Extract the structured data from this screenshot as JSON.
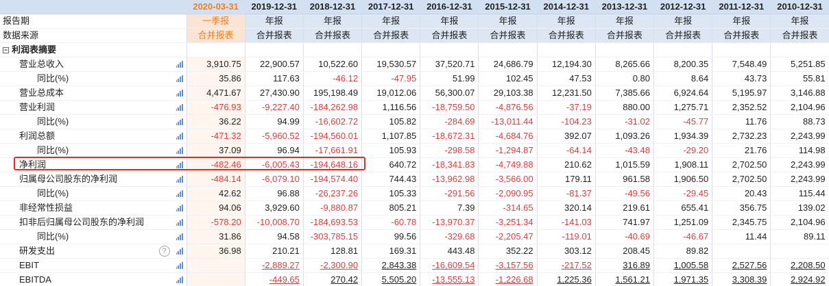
{
  "header": {
    "periods": [
      "2020-03-31",
      "2019-12-31",
      "2018-12-31",
      "2017-12-31",
      "2016-12-31",
      "2015-12-31",
      "2014-12-31",
      "2013-12-31",
      "2012-12-31",
      "2011-12-31",
      "2010-12-31"
    ]
  },
  "meta_rows": [
    {
      "label": "报告期",
      "values": [
        "一季报",
        "年报",
        "年报",
        "年报",
        "年报",
        "年报",
        "年报",
        "年报",
        "年报",
        "年报",
        "年报"
      ]
    },
    {
      "label": "数据来源",
      "values": [
        "合并报表",
        "合并报表",
        "合并报表",
        "合并报表",
        "合并报表",
        "合并报表",
        "合并报表",
        "合并报表",
        "合并报表",
        "合并报表",
        "合并报表"
      ]
    }
  ],
  "section": {
    "collapse_symbol": "−",
    "label": "利润表摘要"
  },
  "icons": {
    "help": "?",
    "accent_color": "#ef7f22",
    "negative_color": "#e23a3a",
    "highlight_color": "#e8271e"
  },
  "rows": [
    {
      "label": "营业总收入",
      "level": 1,
      "values": [
        "3,910.75",
        "22,900.57",
        "10,522.60",
        "19,530.57",
        "37,520.71",
        "24,686.79",
        "12,194.30",
        "8,265.66",
        "8,200.35",
        "7,548.49",
        "5,251.85"
      ]
    },
    {
      "label": "同比(%)",
      "level": 2,
      "values": [
        "35.86",
        "117.63",
        "-46.12",
        "-47.95",
        "51.99",
        "102.45",
        "47.53",
        "0.80",
        "8.64",
        "43.73",
        "55.81"
      ]
    },
    {
      "label": "营业总成本",
      "level": 1,
      "values": [
        "4,471.67",
        "27,430.90",
        "195,198.49",
        "19,012.06",
        "56,300.07",
        "29,103.38",
        "12,231.50",
        "7,385.66",
        "6,924.64",
        "5,195.97",
        "3,146.88"
      ]
    },
    {
      "label": "营业利润",
      "level": 1,
      "values": [
        "-476.93",
        "-9,227.40",
        "-184,262.98",
        "1,116.56",
        "-18,759.50",
        "-4,876.56",
        "-37.19",
        "880.00",
        "1,275.71",
        "2,352.52",
        "2,104.96"
      ]
    },
    {
      "label": "同比(%)",
      "level": 2,
      "values": [
        "36.22",
        "94.99",
        "-16,602.72",
        "105.82",
        "-284.69",
        "-13,011.44",
        "-104.23",
        "-31.02",
        "-45.77",
        "11.76",
        "88.73"
      ]
    },
    {
      "label": "利润总额",
      "level": 1,
      "values": [
        "-471.32",
        "-5,960.52",
        "-194,560.01",
        "1,107.85",
        "-18,672.31",
        "-4,684.76",
        "392.07",
        "1,093.26",
        "1,934.39",
        "2,732.23",
        "2,243.99"
      ]
    },
    {
      "label": "同比(%)",
      "level": 2,
      "values": [
        "37.09",
        "96.94",
        "-17,661.91",
        "105.93",
        "-298.58",
        "-1,294.87",
        "-64.14",
        "-43.48",
        "-29.20",
        "21.76",
        "114.98"
      ]
    },
    {
      "label": "净利润",
      "level": 1,
      "values": [
        "-482.46",
        "-6,005.43",
        "-194,648.16",
        "640.72",
        "-18,341.83",
        "-4,749.88",
        "210.62",
        "1,015.59",
        "1,908.11",
        "2,702.50",
        "2,243.99"
      ]
    },
    {
      "label": "归属母公司股东的净利润",
      "level": 1,
      "values": [
        "-484.14",
        "-6,079.10",
        "-194,574.40",
        "744.43",
        "-13,962.98",
        "-3,566.00",
        "179.11",
        "961.58",
        "1,906.50",
        "2,702.50",
        "2,243.99"
      ]
    },
    {
      "label": "同比(%)",
      "level": 2,
      "values": [
        "42.62",
        "96.88",
        "-26,237.26",
        "105.33",
        "-291.56",
        "-2,090.95",
        "-81.37",
        "-49.56",
        "-29.45",
        "20.43",
        "115.44"
      ]
    },
    {
      "label": "非经常性损益",
      "level": 1,
      "values": [
        "94.06",
        "3,929.60",
        "-9,880.87",
        "805.21",
        "7.39",
        "-314.65",
        "320.14",
        "219.61",
        "655.41",
        "356.75",
        "139.02"
      ]
    },
    {
      "label": "扣非后归属母公司股东的净利润",
      "level": 1,
      "values": [
        "-578.20",
        "-10,008.70",
        "-184,693.53",
        "-60.78",
        "-13,970.37",
        "-3,251.34",
        "-141.03",
        "741.97",
        "1,251.09",
        "2,345.75",
        "2,104.96"
      ]
    },
    {
      "label": "同比(%)",
      "level": 2,
      "values": [
        "31.86",
        "94.58",
        "-303,785.15",
        "99.56",
        "-329.68",
        "-2,205.47",
        "-119.01",
        "-40.69",
        "-46.67",
        "11.44",
        "89.11"
      ]
    },
    {
      "label": "研发支出",
      "level": 1,
      "help": true,
      "values": [
        "36.98",
        "210.21",
        "128.81",
        "169.31",
        "443.48",
        "352.22",
        "303.12",
        "208.45",
        "89.82",
        "",
        ""
      ]
    },
    {
      "label": "EBIT",
      "level": 1,
      "link": true,
      "values": [
        "",
        "-2,889.27",
        "-2,300.90",
        "2,843.38",
        "-16,609.54",
        "-3,157.56",
        "-217.52",
        "316.89",
        "1,005.58",
        "2,527.56",
        "2,208.50"
      ]
    },
    {
      "label": "EBITDA",
      "level": 1,
      "link": true,
      "values": [
        "",
        "-449.65",
        "270.42",
        "5,505.20",
        "-13,555.13",
        "-1,226.68",
        "1,225.36",
        "1,561.21",
        "1,971.35",
        "3,308.39",
        "2,924.92"
      ]
    }
  ]
}
